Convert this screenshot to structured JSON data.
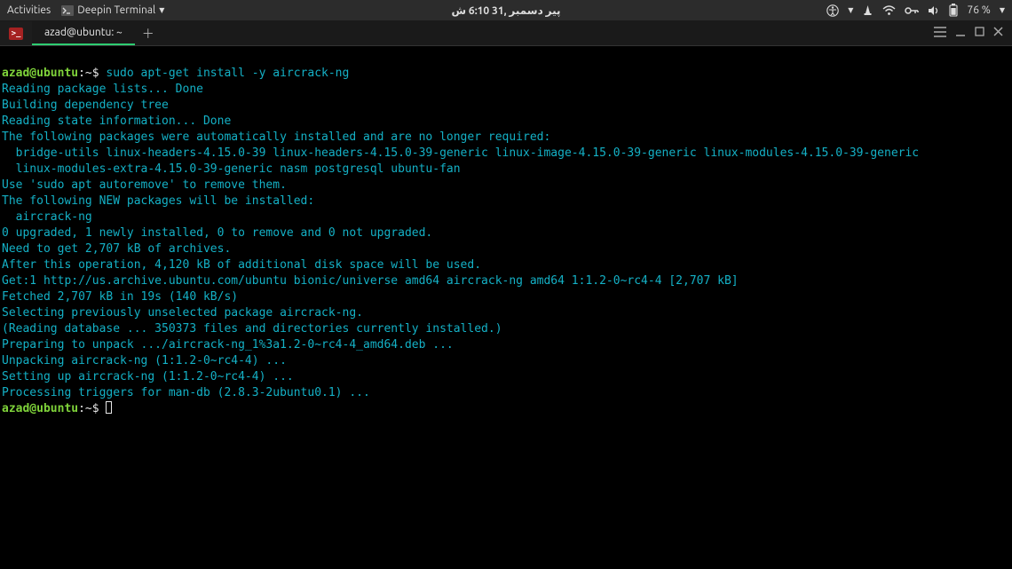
{
  "top_bar": {
    "activities": "Activities",
    "app_name": "Deepin Terminal",
    "clock": "پیر دسمبر ,31 6:10 ش",
    "battery": "76 %"
  },
  "tabs": {
    "title": "azad@ubuntu: ~"
  },
  "terminal": {
    "prompt_user": "azad@ubuntu",
    "prompt_path": ":~$ ",
    "command": "sudo apt-get install -y aircrack-ng",
    "lines": {
      "l01": "Reading package lists... Done",
      "l02": "Building dependency tree",
      "l03": "Reading state information... Done",
      "l04": "The following packages were automatically installed and are no longer required:",
      "l05": "  bridge-utils linux-headers-4.15.0-39 linux-headers-4.15.0-39-generic linux-image-4.15.0-39-generic linux-modules-4.15.0-39-generic",
      "l06": "  linux-modules-extra-4.15.0-39-generic nasm postgresql ubuntu-fan",
      "l07": "Use 'sudo apt autoremove' to remove them.",
      "l08": "The following NEW packages will be installed:",
      "l09": "  aircrack-ng",
      "l10": "0 upgraded, 1 newly installed, 0 to remove and 0 not upgraded.",
      "l11": "Need to get 2,707 kB of archives.",
      "l12": "After this operation, 4,120 kB of additional disk space will be used.",
      "l13": "Get:1 http://us.archive.ubuntu.com/ubuntu bionic/universe amd64 aircrack-ng amd64 1:1.2-0~rc4-4 [2,707 kB]",
      "l14": "Fetched 2,707 kB in 19s (140 kB/s)",
      "l15": "Selecting previously unselected package aircrack-ng.",
      "l16": "(Reading database ... 350373 files and directories currently installed.)",
      "l17": "Preparing to unpack .../aircrack-ng_1%3a1.2-0~rc4-4_amd64.deb ...",
      "l18": "Unpacking aircrack-ng (1:1.2-0~rc4-4) ...",
      "l19": "Setting up aircrack-ng (1:1.2-0~rc4-4) ...",
      "l20": "Processing triggers for man-db (2.8.3-2ubuntu0.1) ..."
    }
  }
}
